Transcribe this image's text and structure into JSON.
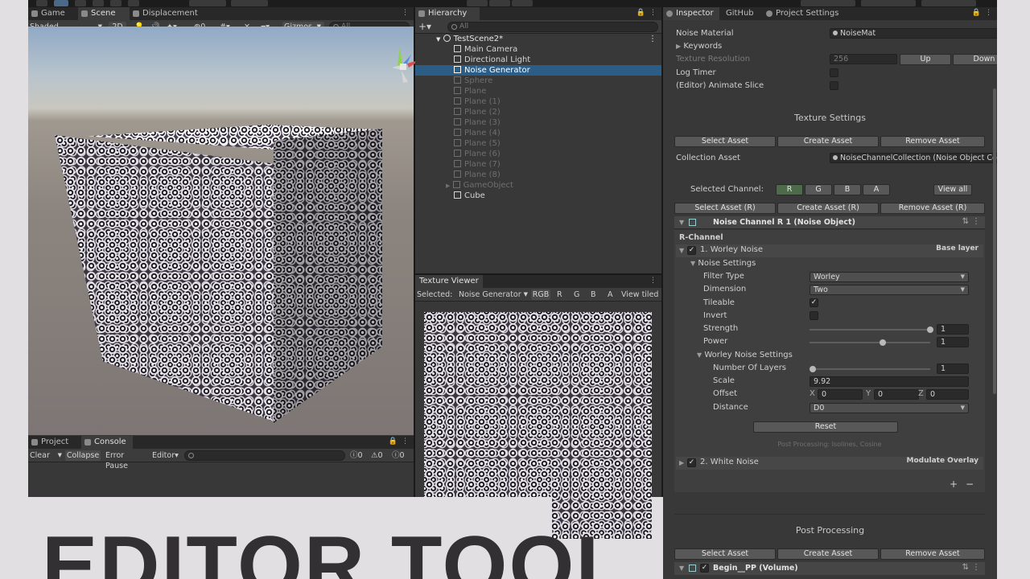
{
  "top_tabs": {
    "game": "Game",
    "scene": "Scene",
    "displacement": "Displacement"
  },
  "scene_toolbar": {
    "shading": "Shaded",
    "mode_2d": "2D",
    "fx_count": "0",
    "gizmos": "Gizmos",
    "search": "All"
  },
  "hierarchy": {
    "tab": "Hierarchy",
    "search": "All",
    "scene": "TestScene2*",
    "items": [
      "Main Camera",
      "Directional Light",
      "Noise Generator",
      "Sphere",
      "Plane",
      "Plane (1)",
      "Plane (2)",
      "Plane (3)",
      "Plane (4)",
      "Plane (5)",
      "Plane (6)",
      "Plane (7)",
      "Plane (8)",
      "GameObject",
      "Cube"
    ]
  },
  "texture_viewer": {
    "tab": "Texture Viewer",
    "selected_label": "Selected:",
    "selected_value": "Noise Generator",
    "channels": [
      "RGB",
      "R",
      "G",
      "B",
      "A"
    ],
    "view_tiled": "View tiled"
  },
  "console": {
    "tab_project": "Project",
    "tab_console": "Console",
    "clear": "Clear",
    "collapse": "Collapse",
    "error_pause": "Error Pause",
    "editor": "Editor",
    "count_log": "0",
    "count_warn": "0",
    "count_err": "0"
  },
  "inspector": {
    "tabs": {
      "inspector": "Inspector",
      "github": "GitHub",
      "project_settings": "Project Settings"
    },
    "noise_material_label": "Noise Material",
    "noise_material_value": "NoiseMat",
    "keywords": "Keywords",
    "texture_resolution_label": "Texture Resolution",
    "texture_resolution_value": "256",
    "up": "Up",
    "down": "Down",
    "log_timer": "Log Timer",
    "animate_slice": "(Editor) Animate Slice",
    "texture_settings": "Texture Settings",
    "select_asset": "Select Asset",
    "create_asset": "Create Asset",
    "remove_asset": "Remove Asset",
    "collection_asset_label": "Collection Asset",
    "collection_asset_value": "NoiseChannelCollection (Noise Object Collec",
    "selected_channel": "Selected Channel:",
    "channels": [
      "R",
      "G",
      "B",
      "A"
    ],
    "view_all": "View all",
    "select_asset_r": "Select Asset (R)",
    "create_asset_r": "Create Asset (R)",
    "remove_asset_r": "Remove Asset (R)",
    "noise_channel": "Noise Channel R 1 (Noise Object)",
    "r_channel": "R-Channel",
    "layer1": "1. Worley Noise",
    "base_layer": "Base layer",
    "noise_settings": "Noise Settings",
    "filter_type_label": "Filter Type",
    "filter_type_value": "Worley",
    "dimension_label": "Dimension",
    "dimension_value": "Two",
    "tileable": "Tileable",
    "invert": "Invert",
    "strength_label": "Strength",
    "strength_value": "1",
    "power_label": "Power",
    "power_value": "1",
    "worley_settings": "Worley Noise Settings",
    "layers_label": "Number Of Layers",
    "layers_value": "1",
    "scale_label": "Scale",
    "scale_value": "9.92",
    "offset_label": "Offset",
    "offset_x": "0",
    "offset_y": "0",
    "offset_z": "0",
    "distance_label": "Distance",
    "distance_value": "D0",
    "reset": "Reset",
    "pp_hint": "Post Processing: Isolines, Cosine",
    "layer2": "2. White Noise",
    "modulate_overlay": "Modulate Overlay",
    "plus": "+",
    "minus": "−",
    "post_processing": "Post Processing",
    "pp_select": "Select Asset",
    "pp_create": "Create Asset",
    "pp_remove": "Remove Asset",
    "begin_pp": "Begin__PP (Volume)"
  },
  "banner": {
    "title": "EDITOR TOOL"
  }
}
